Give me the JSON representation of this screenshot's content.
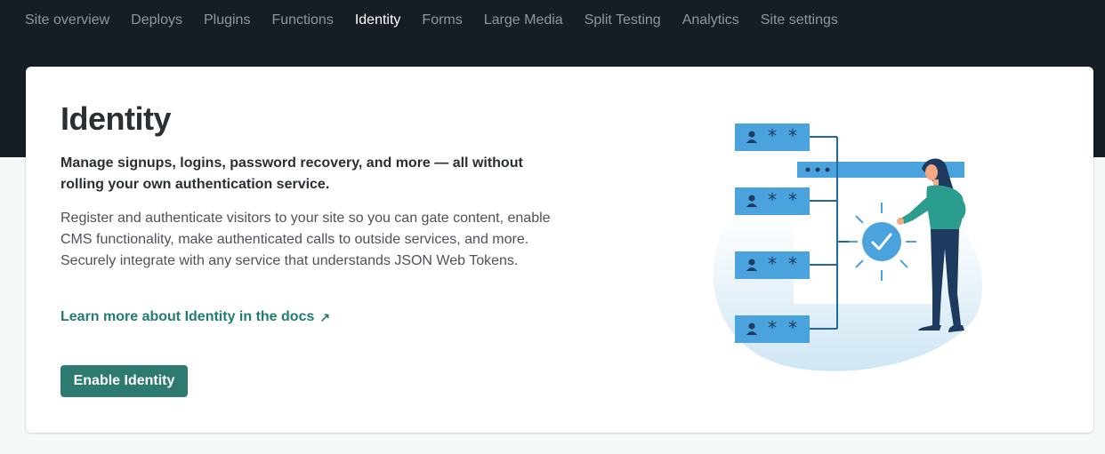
{
  "nav": {
    "items": [
      {
        "label": "Site overview",
        "active": false
      },
      {
        "label": "Deploys",
        "active": false
      },
      {
        "label": "Plugins",
        "active": false
      },
      {
        "label": "Functions",
        "active": false
      },
      {
        "label": "Identity",
        "active": true
      },
      {
        "label": "Forms",
        "active": false
      },
      {
        "label": "Large Media",
        "active": false
      },
      {
        "label": "Split Testing",
        "active": false
      },
      {
        "label": "Analytics",
        "active": false
      },
      {
        "label": "Site settings",
        "active": false
      }
    ]
  },
  "card": {
    "title": "Identity",
    "lead": "Manage signups, logins, password recovery, and more — all without rolling your own authentication service.",
    "body": "Register and authenticate visitors to your site so you can gate content, enable CMS functionality, make authenticated calls to outside services, and more. Securely integrate with any service that understands JSON Web Tokens.",
    "docs_link": "Learn more about Identity in the docs",
    "docs_link_icon": "external-arrow-icon",
    "enable_button": "Enable Identity"
  },
  "illustration": {
    "icon": "identity-illustration",
    "colors": {
      "primary_blue": "#3f9bd8",
      "dark_navy": "#1e3a5f",
      "line_blue": "#1f6aa5",
      "teal_shirt": "#2a9d8f",
      "blob": "#dceef8",
      "skin": "#f4a983"
    }
  },
  "colors": {
    "nav_bg": "#171d24",
    "page_bg": "#f5f9fa",
    "accent": "#2d7a70",
    "link": "#217d72"
  }
}
